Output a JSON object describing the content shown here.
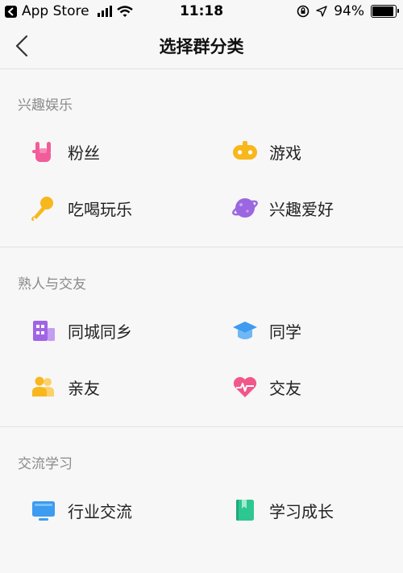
{
  "status": {
    "back_app": "App Store",
    "time": "11:18",
    "battery": "94%",
    "battery_level": 0.94
  },
  "nav": {
    "title": "选择群分类"
  },
  "sections": [
    {
      "title": "兴趣娱乐",
      "items": [
        {
          "label": "粉丝",
          "icon": "rock-hand-icon",
          "color": "#f25c9b"
        },
        {
          "label": "游戏",
          "icon": "gamepad-icon",
          "color": "#f8b71d"
        },
        {
          "label": "吃喝玩乐",
          "icon": "microphone-icon",
          "color": "#f8b71d"
        },
        {
          "label": "兴趣爱好",
          "icon": "planet-icon",
          "color": "#9b67e0"
        }
      ]
    },
    {
      "title": "熟人与交友",
      "items": [
        {
          "label": "同城同乡",
          "icon": "building-icon",
          "color": "#a064e6"
        },
        {
          "label": "同学",
          "icon": "graduation-cap-icon",
          "color": "#3d9bf0"
        },
        {
          "label": "亲友",
          "icon": "people-icon",
          "color": "#f8b71d"
        },
        {
          "label": "交友",
          "icon": "heart-pulse-icon",
          "color": "#f2578a"
        }
      ]
    },
    {
      "title": "交流学习",
      "items": [
        {
          "label": "行业交流",
          "icon": "monitor-icon",
          "color": "#3d9bf0"
        },
        {
          "label": "学习成长",
          "icon": "book-icon",
          "color": "#2ec792"
        }
      ]
    }
  ]
}
